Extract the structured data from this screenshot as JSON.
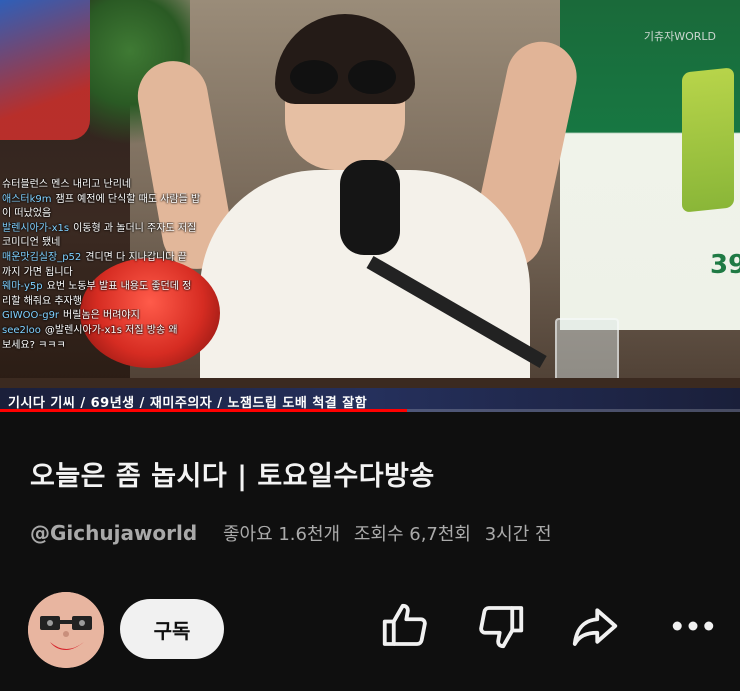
{
  "video": {
    "watermark": "기츄자WORLD",
    "caption": "기시다 기씨 / 69년생 / 재미주의자 / 노잼드립 도배 척결 잘함",
    "progress_fraction": 0.55,
    "poster_number": "39",
    "chat": [
      {
        "nick": "",
        "text": "슈터블런스 멘스 내리고 난리네"
      },
      {
        "nick": "애스터k9m",
        "text": "잼프 예전에 단식할 때도 사람들 밥"
      },
      {
        "nick": "",
        "text": "이 떠났었음"
      },
      {
        "nick": "발렌시아가-x1s",
        "text": "이동형 과 놀더니 주자도 저질"
      },
      {
        "nick": "",
        "text": "코미디언 됐네"
      },
      {
        "nick": "매운맛김실장_p52",
        "text": "견디면 다 지나갑니다 끝"
      },
      {
        "nick": "",
        "text": "까지 가면 됩니다"
      },
      {
        "nick": "웨마-y5p",
        "text": "요번 노동부 발표 내용도 좋던데 정"
      },
      {
        "nick": "",
        "text": "리할 해줘요 추자행"
      },
      {
        "nick": "GIWOO-g9r",
        "text": "버릴놈은 버려야지"
      },
      {
        "nick": "see2loo",
        "text": "@발렌시아가-x1s 저질 방송 왜"
      },
      {
        "nick": "",
        "text": "보세요? ㅋㅋㅋ"
      }
    ]
  },
  "info": {
    "title": "오늘은 좀 놉시다 | 토요일수다방송",
    "channel": "@Gichujaworld",
    "likes": "좋아요 1.6천개",
    "views": "조회수 6,7천회",
    "age": "3시간 전"
  },
  "actions": {
    "subscribe_label": "구독",
    "icons": [
      "thumbs-up-icon",
      "thumbs-down-icon",
      "share-icon",
      "more-icon"
    ]
  },
  "colors": {
    "background": "#0f0f0f",
    "subscribe_bg": "#f1f1f1",
    "progress": "#ff0000"
  }
}
